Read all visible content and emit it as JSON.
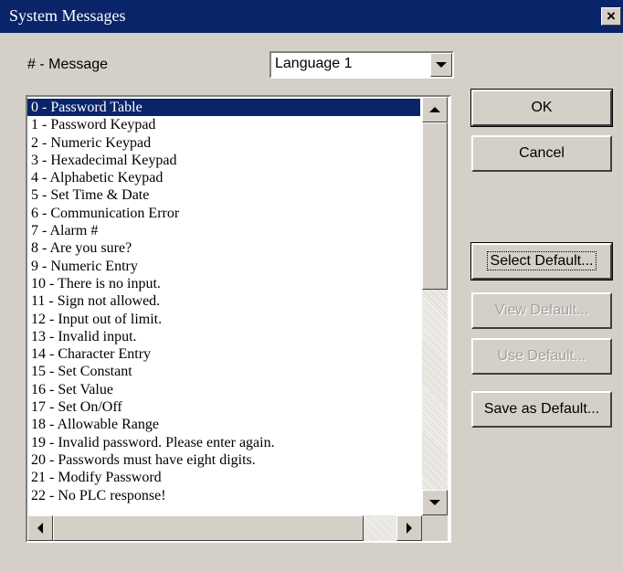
{
  "window": {
    "title": "System Messages",
    "close_label": "×"
  },
  "header": {
    "message_label": "# - Message"
  },
  "language_select": {
    "value": "Language 1"
  },
  "messages": [
    "0 - Password Table",
    "1 - Password Keypad",
    "2 - Numeric Keypad",
    "3 - Hexadecimal Keypad",
    "4 - Alphabetic Keypad",
    "5 - Set Time & Date",
    "6 - Communication Error",
    "7 - Alarm #",
    "8 - Are you sure?",
    "9 - Numeric Entry",
    "10 - There is no input.",
    "11 - Sign not allowed.",
    "12 - Input out of limit.",
    "13 - Invalid input.",
    "14 - Character Entry",
    "15 - Set Constant",
    "16 - Set Value",
    "17 - Set On/Off",
    "18 - Allowable Range",
    "19 - Invalid password. Please enter again.",
    "20 - Passwords must have eight digits.",
    "21 - Modify Password",
    "22 - No PLC response!"
  ],
  "selected_index": 0,
  "buttons": {
    "ok": "OK",
    "cancel": "Cancel",
    "select_default": "Select Default...",
    "view_default": "View Default...",
    "use_default": "Use Default...",
    "save_as_default": "Save as Default..."
  },
  "colors": {
    "titlebar": "#0a246a",
    "selection": "#0a246a",
    "face": "#d4d0c8",
    "disabled_text": "#a0a0a0"
  }
}
